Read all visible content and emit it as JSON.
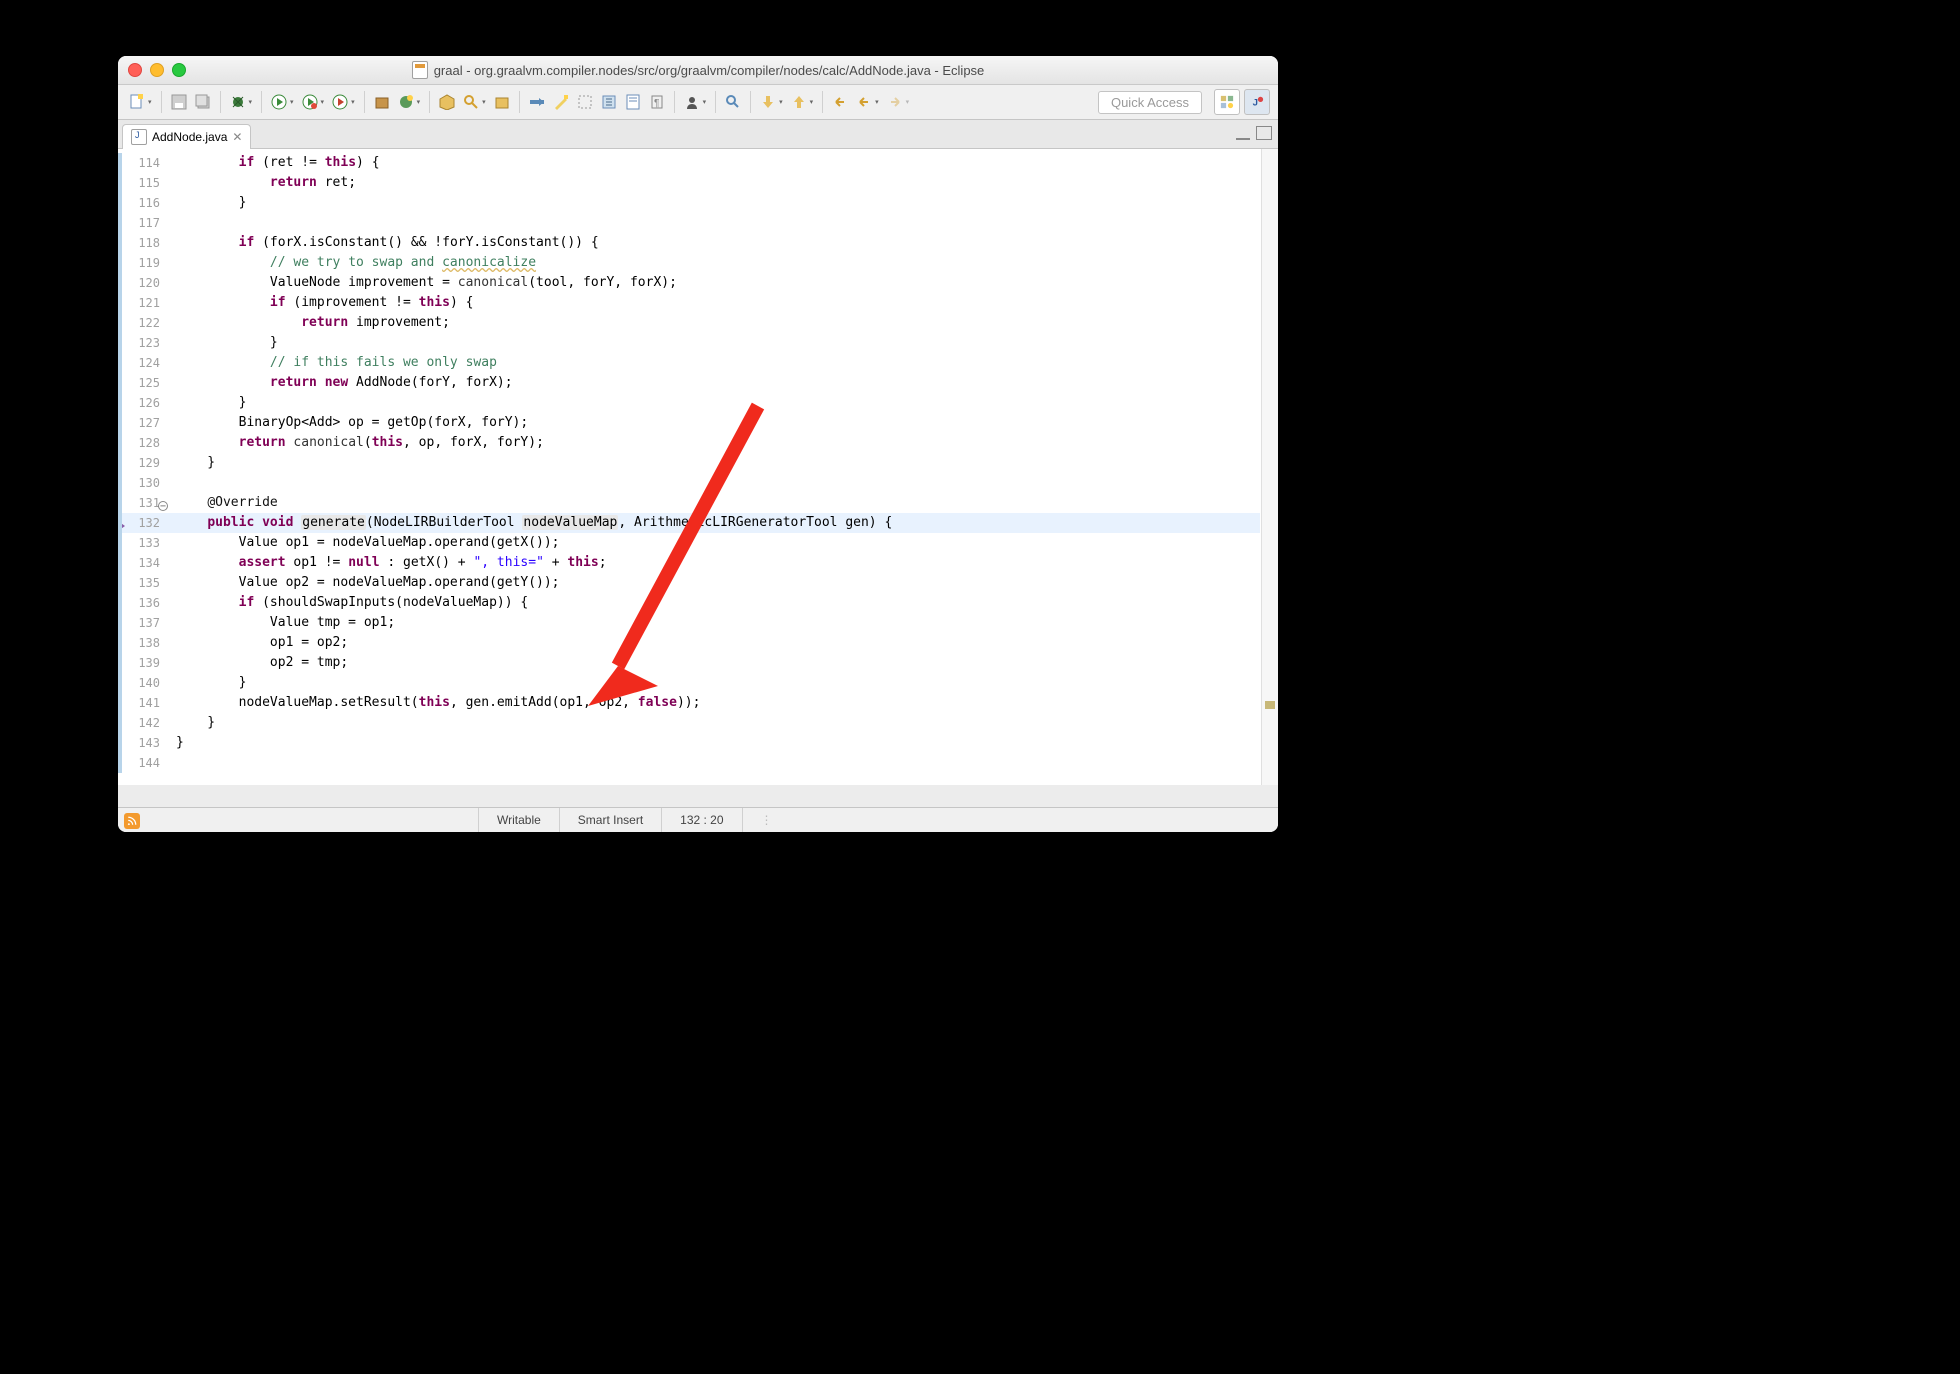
{
  "window": {
    "title": "graal - org.graalvm.compiler.nodes/src/org/graalvm/compiler/nodes/calc/AddNode.java - Eclipse",
    "quick_access": "Quick Access"
  },
  "tab": {
    "label": "AddNode.java"
  },
  "status": {
    "writable": "Writable",
    "insert": "Smart Insert",
    "pos": "132 : 20"
  },
  "code": {
    "lines": [
      {
        "n": 114,
        "html": "        <span class='kw'>if</span> (ret != <span class='kw'>this</span>) {"
      },
      {
        "n": 115,
        "html": "            <span class='kw'>return</span> ret;"
      },
      {
        "n": 116,
        "html": "        }"
      },
      {
        "n": 117,
        "html": ""
      },
      {
        "n": 118,
        "html": "        <span class='kw'>if</span> (forX.isConstant() && !forY.isConstant()) {"
      },
      {
        "n": 119,
        "html": "            <span class='cm'>// we try to swap and </span><span class='cm sq'>canonicalize</span>"
      },
      {
        "n": 120,
        "html": "            ValueNode improvement = <span class='fn'>canonical</span>(tool, forY, forX);"
      },
      {
        "n": 121,
        "html": "            <span class='kw'>if</span> (improvement != <span class='kw'>this</span>) {"
      },
      {
        "n": 122,
        "html": "                <span class='kw'>return</span> improvement;"
      },
      {
        "n": 123,
        "html": "            }"
      },
      {
        "n": 124,
        "html": "            <span class='cm'>// if this fails we only swap</span>"
      },
      {
        "n": 125,
        "html": "            <span class='kw'>return</span> <span class='kw'>new</span> AddNode(forY, forX);"
      },
      {
        "n": 126,
        "html": "        }"
      },
      {
        "n": 127,
        "html": "        BinaryOp&lt;Add&gt; op = getOp(forX, forY);"
      },
      {
        "n": 128,
        "html": "        <span class='kw'>return</span> <span class='fn'>canonical</span>(<span class='kw'>this</span>, op, forX, forY);"
      },
      {
        "n": 129,
        "html": "    }"
      },
      {
        "n": 130,
        "html": ""
      },
      {
        "n": 131,
        "html": "    <span class='id'>@Override</span>",
        "mark": "fold"
      },
      {
        "n": 132,
        "html": "    <span class='kw'>public</span> <span class='kw'>void</span> <span class='box'>generate</span>(NodeLIRBuilderTool <span class='box'>nodeValueMap</span>, ArithmeticLIRGeneratorTool gen) {",
        "mark": "tri",
        "hl": true
      },
      {
        "n": 133,
        "html": "        Value op1 = nodeValueMap.operand(getX());"
      },
      {
        "n": 134,
        "html": "        <span class='kw'>assert</span> op1 != <span class='kw'>null</span> : getX() + <span class='str'>\", this=\"</span> + <span class='kw'>this</span>;"
      },
      {
        "n": 135,
        "html": "        Value op2 = nodeValueMap.operand(getY());"
      },
      {
        "n": 136,
        "html": "        <span class='kw'>if</span> (shouldSwapInputs(nodeValueMap)) {"
      },
      {
        "n": 137,
        "html": "            Value tmp = op1;"
      },
      {
        "n": 138,
        "html": "            op1 = op2;"
      },
      {
        "n": 139,
        "html": "            op2 = tmp;"
      },
      {
        "n": 140,
        "html": "        }"
      },
      {
        "n": 141,
        "html": "        nodeValueMap.setResult(<span class='kw'>this</span>, gen.emitAdd(op1, op2, <span class='kw'>false</span>));"
      },
      {
        "n": 142,
        "html": "    }"
      },
      {
        "n": 143,
        "html": "}"
      },
      {
        "n": 144,
        "html": ""
      }
    ]
  }
}
